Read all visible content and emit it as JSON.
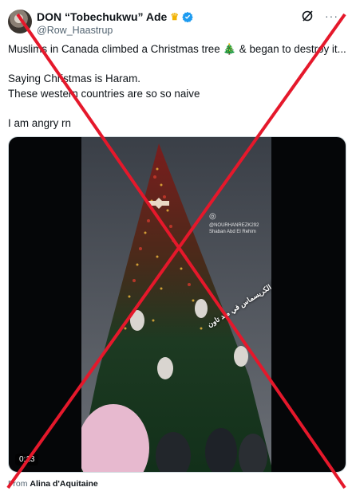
{
  "author": {
    "name": "DON “Tobechukwu” Ade",
    "crown_icon": "crown-icon",
    "verified_icon": "verified-badge-icon",
    "handle": "@Row_Haastrup"
  },
  "tweet": {
    "line1": "Muslims in Canada climbed a Christmas tree 🎄 & began to destroy it...",
    "line2": "Saying Christmas is Haram.",
    "line3": "These western countries are so so naive",
    "line4": "I am angry rn"
  },
  "media": {
    "timestamp": "0:13",
    "watermark_handle": "@NOURHANREZK292",
    "watermark_sub": "Shaban Abd El Rehim",
    "arabic_caption": "الكريسماس في ميد تاون 😂😂"
  },
  "footer": {
    "from_label": "From",
    "from_source": "Alina d'Aquitaine"
  },
  "colors": {
    "accent_blue": "#1d9bf0",
    "cross_red": "#e5182b",
    "muted": "#536471"
  }
}
